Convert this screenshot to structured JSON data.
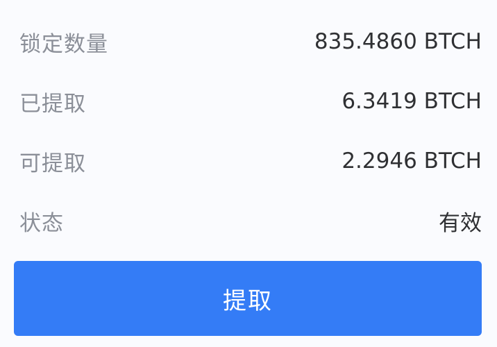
{
  "details": {
    "rows": [
      {
        "label": "锁定数量",
        "value": "835.4860 BTCH"
      },
      {
        "label": "已提取",
        "value": "6.3419 BTCH"
      },
      {
        "label": "可提取",
        "value": "2.2946 BTCH"
      },
      {
        "label": "状态",
        "value": "有效"
      }
    ]
  },
  "actions": {
    "withdraw_label": "提取"
  },
  "colors": {
    "background": "#fafbfe",
    "label": "#8b8f98",
    "value": "#2f3033",
    "primary_button": "#347cf6",
    "button_text": "#ffffff"
  }
}
